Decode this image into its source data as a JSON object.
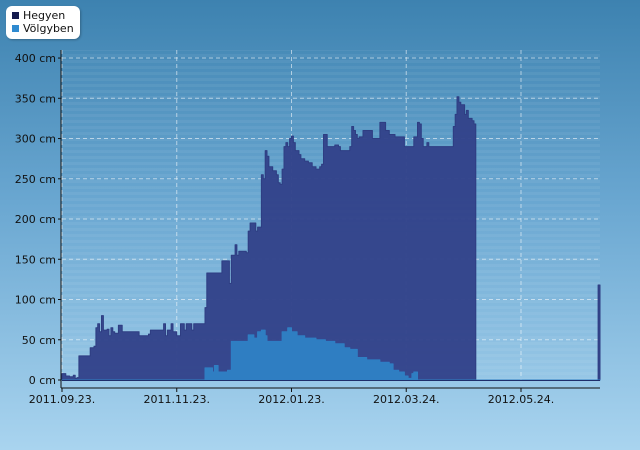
{
  "chart_data": {
    "type": "area",
    "title": "",
    "xlabel": "",
    "ylabel": "",
    "y_unit": "cm",
    "ylim": [
      0,
      410
    ],
    "y_ticks": [
      {
        "value": 0,
        "label": "0 cm"
      },
      {
        "value": 50,
        "label": "50 cm"
      },
      {
        "value": 100,
        "label": "100 cm"
      },
      {
        "value": 150,
        "label": "150 cm"
      },
      {
        "value": 200,
        "label": "200 cm"
      },
      {
        "value": 250,
        "label": "250 cm"
      },
      {
        "value": 300,
        "label": "300 cm"
      },
      {
        "value": 350,
        "label": "350 cm"
      },
      {
        "value": 400,
        "label": "400 cm"
      }
    ],
    "xlim": [
      "2011-09-23",
      "2012-07-05"
    ],
    "x_ticks": [
      {
        "date": "2011-09-23",
        "label": "2011.09.23."
      },
      {
        "date": "2011-11-23",
        "label": "2011.11.23."
      },
      {
        "date": "2012-01-23",
        "label": "2012.01.23."
      },
      {
        "date": "2012-03-24",
        "label": "2012.03.24."
      },
      {
        "date": "2012-05-24",
        "label": "2012.05.24."
      }
    ],
    "grid": true,
    "legend_position": "top-left",
    "series": [
      {
        "name": "Hegyen",
        "color": "#2e3d82",
        "fill": "#33438a",
        "points": [
          [
            "2011-09-23",
            8
          ],
          [
            "2011-09-25",
            5
          ],
          [
            "2011-09-27",
            4
          ],
          [
            "2011-09-29",
            6
          ],
          [
            "2011-09-30",
            2
          ],
          [
            "2011-10-01",
            3
          ],
          [
            "2011-10-02",
            30
          ],
          [
            "2011-10-07",
            30
          ],
          [
            "2011-10-08",
            40
          ],
          [
            "2011-10-10",
            42
          ],
          [
            "2011-10-11",
            65
          ],
          [
            "2011-10-12",
            70
          ],
          [
            "2011-10-13",
            60
          ],
          [
            "2011-10-14",
            80
          ],
          [
            "2011-10-15",
            62
          ],
          [
            "2011-10-17",
            63
          ],
          [
            "2011-10-18",
            55
          ],
          [
            "2011-10-19",
            65
          ],
          [
            "2011-10-20",
            60
          ],
          [
            "2011-10-21",
            58
          ],
          [
            "2011-10-23",
            68
          ],
          [
            "2011-10-25",
            60
          ],
          [
            "2011-11-01",
            60
          ],
          [
            "2011-11-03",
            55
          ],
          [
            "2011-11-08",
            57
          ],
          [
            "2011-11-09",
            62
          ],
          [
            "2011-11-15",
            62
          ],
          [
            "2011-11-16",
            70
          ],
          [
            "2011-11-17",
            55
          ],
          [
            "2011-11-18",
            62
          ],
          [
            "2011-11-20",
            70
          ],
          [
            "2011-11-21",
            60
          ],
          [
            "2011-11-23",
            55
          ],
          [
            "2011-11-25",
            70
          ],
          [
            "2011-11-27",
            62
          ],
          [
            "2011-11-28",
            70
          ],
          [
            "2011-11-30",
            70
          ],
          [
            "2011-12-01",
            62
          ],
          [
            "2011-12-02",
            70
          ],
          [
            "2011-12-07",
            70
          ],
          [
            "2011-12-08",
            90
          ],
          [
            "2011-12-09",
            133
          ],
          [
            "2011-12-15",
            133
          ],
          [
            "2011-12-17",
            148
          ],
          [
            "2011-12-20",
            148
          ],
          [
            "2011-12-21",
            120
          ],
          [
            "2011-12-22",
            155
          ],
          [
            "2011-12-24",
            168
          ],
          [
            "2011-12-25",
            155
          ],
          [
            "2011-12-26",
            160
          ],
          [
            "2011-12-30",
            158
          ],
          [
            "2011-12-31",
            185
          ],
          [
            "2012-01-01",
            195
          ],
          [
            "2012-01-03",
            195
          ],
          [
            "2012-01-04",
            185
          ],
          [
            "2012-01-05",
            190
          ],
          [
            "2012-01-07",
            255
          ],
          [
            "2012-01-08",
            250
          ],
          [
            "2012-01-09",
            285
          ],
          [
            "2012-01-10",
            278
          ],
          [
            "2012-01-11",
            265
          ],
          [
            "2012-01-13",
            260
          ],
          [
            "2012-01-15",
            255
          ],
          [
            "2012-01-16",
            245
          ],
          [
            "2012-01-17",
            243
          ],
          [
            "2012-01-18",
            262
          ],
          [
            "2012-01-19",
            290
          ],
          [
            "2012-01-20",
            295
          ],
          [
            "2012-01-21",
            290
          ],
          [
            "2012-01-22",
            300
          ],
          [
            "2012-01-23",
            303
          ],
          [
            "2012-01-24",
            295
          ],
          [
            "2012-01-25",
            285
          ],
          [
            "2012-01-27",
            280
          ],
          [
            "2012-01-28",
            275
          ],
          [
            "2012-01-30",
            272
          ],
          [
            "2012-02-01",
            270
          ],
          [
            "2012-02-03",
            265
          ],
          [
            "2012-02-05",
            262
          ],
          [
            "2012-02-07",
            265
          ],
          [
            "2012-02-08",
            268
          ],
          [
            "2012-02-09",
            305
          ],
          [
            "2012-02-11",
            290
          ],
          [
            "2012-02-15",
            292
          ],
          [
            "2012-02-17",
            290
          ],
          [
            "2012-02-18",
            285
          ],
          [
            "2012-02-22",
            285
          ],
          [
            "2012-02-23",
            290
          ],
          [
            "2012-02-24",
            315
          ],
          [
            "2012-02-25",
            310
          ],
          [
            "2012-02-26",
            305
          ],
          [
            "2012-02-27",
            300
          ],
          [
            "2012-02-28",
            302
          ],
          [
            "2012-03-01",
            310
          ],
          [
            "2012-03-05",
            310
          ],
          [
            "2012-03-06",
            300
          ],
          [
            "2012-03-09",
            300
          ],
          [
            "2012-03-10",
            320
          ],
          [
            "2012-03-13",
            310
          ],
          [
            "2012-03-15",
            305
          ],
          [
            "2012-03-18",
            302
          ],
          [
            "2012-03-22",
            302
          ],
          [
            "2012-03-23",
            290
          ],
          [
            "2012-03-26",
            290
          ],
          [
            "2012-03-28",
            302
          ],
          [
            "2012-03-30",
            320
          ],
          [
            "2012-03-31",
            318
          ],
          [
            "2012-04-01",
            300
          ],
          [
            "2012-04-02",
            290
          ],
          [
            "2012-04-04",
            295
          ],
          [
            "2012-04-05",
            290
          ],
          [
            "2012-04-15",
            290
          ],
          [
            "2012-04-18",
            315
          ],
          [
            "2012-04-19",
            330
          ],
          [
            "2012-04-20",
            352
          ],
          [
            "2012-04-21",
            345
          ],
          [
            "2012-04-22",
            342
          ],
          [
            "2012-04-24",
            330
          ],
          [
            "2012-04-25",
            335
          ],
          [
            "2012-04-26",
            325
          ],
          [
            "2012-04-28",
            322
          ],
          [
            "2012-04-29",
            318
          ],
          [
            "2012-04-30",
            0
          ],
          [
            "2012-07-03",
            0
          ],
          [
            "2012-07-04",
            118
          ],
          [
            "2012-07-05",
            118
          ]
        ]
      },
      {
        "name": "Völgyben",
        "color": "#2f7fc4",
        "fill": "#3080c4",
        "points": [
          [
            "2011-09-23",
            0
          ],
          [
            "2011-12-07",
            0
          ],
          [
            "2011-12-08",
            15
          ],
          [
            "2011-12-12",
            10
          ],
          [
            "2011-12-13",
            18
          ],
          [
            "2011-12-15",
            10
          ],
          [
            "2011-12-20",
            12
          ],
          [
            "2011-12-22",
            48
          ],
          [
            "2011-12-30",
            48
          ],
          [
            "2011-12-31",
            56
          ],
          [
            "2012-01-03",
            52
          ],
          [
            "2012-01-05",
            60
          ],
          [
            "2012-01-07",
            62
          ],
          [
            "2012-01-09",
            55
          ],
          [
            "2012-01-10",
            48
          ],
          [
            "2012-01-17",
            48
          ],
          [
            "2012-01-18",
            60
          ],
          [
            "2012-01-21",
            65
          ],
          [
            "2012-01-23",
            60
          ],
          [
            "2012-01-26",
            55
          ],
          [
            "2012-01-30",
            52
          ],
          [
            "2012-02-05",
            50
          ],
          [
            "2012-02-10",
            48
          ],
          [
            "2012-02-15",
            45
          ],
          [
            "2012-02-20",
            40
          ],
          [
            "2012-02-23",
            38
          ],
          [
            "2012-02-27",
            28
          ],
          [
            "2012-03-03",
            25
          ],
          [
            "2012-03-10",
            22
          ],
          [
            "2012-03-15",
            20
          ],
          [
            "2012-03-17",
            12
          ],
          [
            "2012-03-20",
            10
          ],
          [
            "2012-03-23",
            5
          ],
          [
            "2012-03-25",
            2
          ],
          [
            "2012-03-27",
            8
          ],
          [
            "2012-03-28",
            10
          ],
          [
            "2012-03-30",
            0
          ],
          [
            "2012-07-05",
            0
          ]
        ]
      }
    ]
  }
}
